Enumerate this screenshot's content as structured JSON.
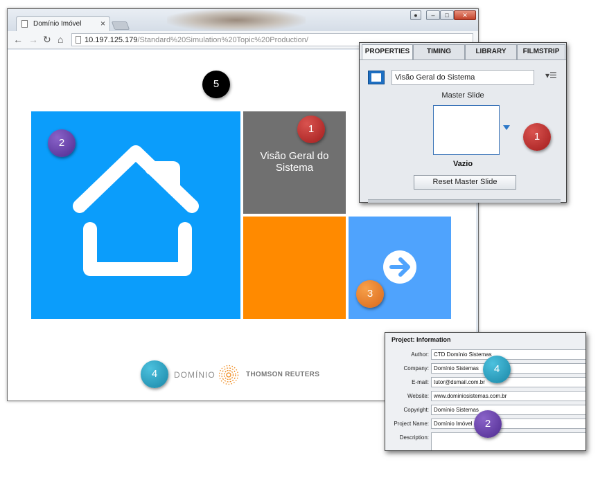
{
  "browser": {
    "tab_title": "Domínio Imóvel",
    "tab_close": "×",
    "url_host": "10.197.125.179",
    "url_path": "/Standard%20Simulation%20Topic%20Production/"
  },
  "slide": {
    "tile_title": "Visão Geral do Sistema",
    "brand_dominio": "DOMÍNIO",
    "brand_reuters": "THOMSON REUTERS",
    "colors": {
      "home_tile": "#0b9dfb",
      "gray_tile": "#707070",
      "orange_tile": "#ff8a00",
      "arrow_tile": "#4fa3fd"
    }
  },
  "callouts": {
    "slide_title_badge": "1",
    "home_badge": "2",
    "arrow_badge": "3",
    "footer_badge": "4",
    "top_badge": "5",
    "props_badge": "1",
    "info_company_badge": "4",
    "info_project_badge": "2"
  },
  "properties_panel": {
    "tabs": [
      "PROPERTIES",
      "TIMING",
      "LIBRARY",
      "FILMSTRIP"
    ],
    "slide_name": "Visão Geral do Sistema",
    "master_slide_label": "Master Slide",
    "master_name": "Vazio",
    "reset_button": "Reset Master Slide"
  },
  "project_info": {
    "title": "Project: Information",
    "fields": [
      {
        "label": "Author:",
        "value": "CTD Domínio Sistemas"
      },
      {
        "label": "Company:",
        "value": "Domínio Sistemas"
      },
      {
        "label": "E-mail:",
        "value": "tutor@dsmail.com.br"
      },
      {
        "label": "Website:",
        "value": "www.dominiosistemas.com.br"
      },
      {
        "label": "Copyright:",
        "value": "Domínio Sistemas"
      },
      {
        "label": "Project Name:",
        "value": "Domínio Imóvel"
      }
    ],
    "description_label": "Description:"
  }
}
